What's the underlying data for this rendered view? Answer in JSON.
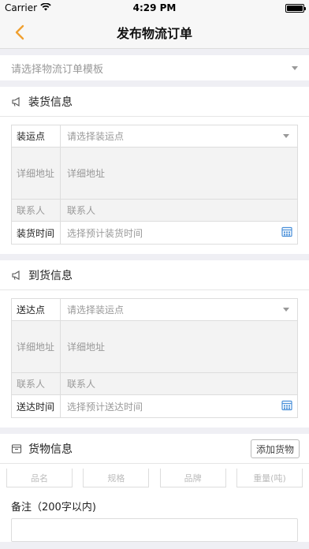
{
  "status_bar": {
    "carrier": "Carrier",
    "time": "4:29 PM"
  },
  "nav": {
    "title": "发布物流订单"
  },
  "template": {
    "placeholder": "请选择物流订单模板"
  },
  "loading": {
    "title": "装货信息",
    "point_label": "装运点",
    "point_placeholder": "请选择装运点",
    "address_label": "详细地址",
    "address_placeholder": "详细地址",
    "contact_label": "联系人",
    "contact_placeholder": "联系人",
    "time_label": "装货时间",
    "time_placeholder": "选择预计装货时间"
  },
  "arrival": {
    "title": "到货信息",
    "point_label": "送达点",
    "point_placeholder": "请选择装运点",
    "address_label": "详细地址",
    "address_placeholder": "详细地址",
    "contact_label": "联系人",
    "contact_placeholder": "联系人",
    "time_label": "送达时间",
    "time_placeholder": "选择预计送达时间"
  },
  "goods": {
    "title": "货物信息",
    "add_button": "添加货物",
    "fields": [
      "品名",
      "规格",
      "品牌",
      "重量(吨)"
    ]
  },
  "remark": {
    "label": "备注（200字以内)"
  },
  "colors": {
    "accent": "#f0a030",
    "calendar": "#4a90d9"
  }
}
